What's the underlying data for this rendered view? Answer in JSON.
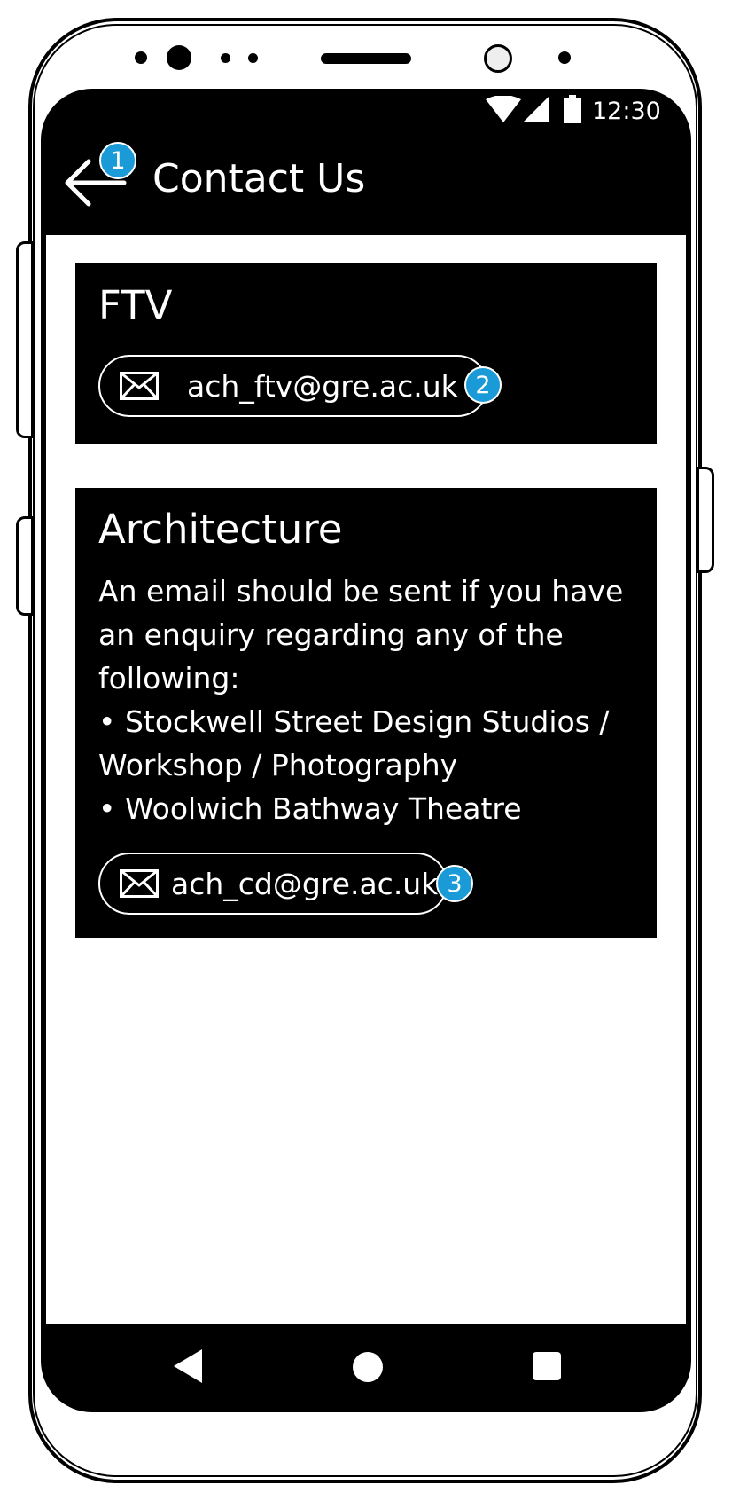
{
  "status_bar": {
    "time": "12:30",
    "icons": [
      "wifi-icon",
      "signal-icon",
      "battery-icon"
    ]
  },
  "app_bar": {
    "title": "Contact Us",
    "back_icon": "arrow-left-icon"
  },
  "cards": [
    {
      "title": "FTV",
      "body_lines": [],
      "email": "ach_ftv@gre.ac.uk"
    },
    {
      "title": "Architecture",
      "body_lines": [
        "An email should be sent if you have",
        "an enquiry regarding any of the",
        "following:",
        "• Stockwell Street Design Studios /",
        "Workshop / Photography",
        "• Woolwich Bathway Theatre"
      ],
      "email": "ach_cd@gre.ac.uk"
    }
  ],
  "markers": [
    "1",
    "2",
    "3"
  ],
  "nav_bar": {
    "icons": [
      "back-triangle-icon",
      "home-circle-icon",
      "recents-square-icon"
    ]
  },
  "colors": {
    "screen": "#000000",
    "content": "#ffffff",
    "marker": "#1a9ad6"
  }
}
